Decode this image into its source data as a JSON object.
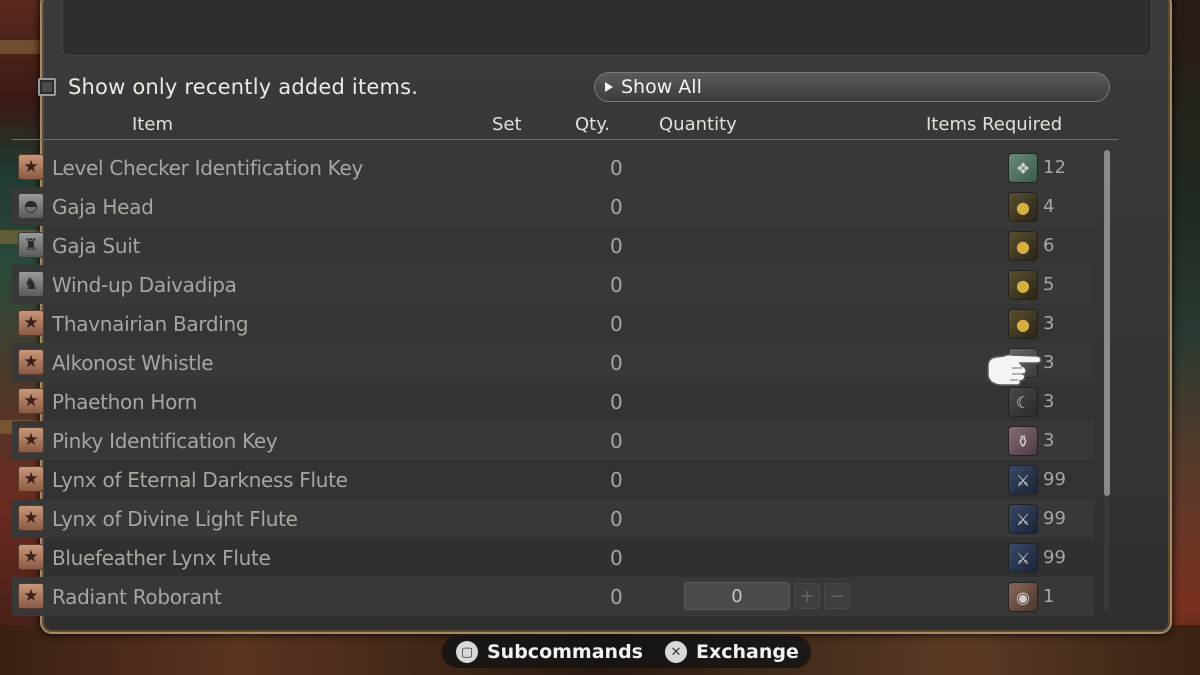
{
  "filter": {
    "label": "Show only recently added items."
  },
  "show_all": {
    "label": "Show All"
  },
  "columns": {
    "item": "Item",
    "set": "Set",
    "qty": "Qty.",
    "quantity": "Quantity",
    "items_required": "Items Required"
  },
  "items": [
    {
      "name": "Level Checker Identification Key",
      "qty": "0",
      "icon": "star-icon",
      "req_icon": "scrip-icon",
      "req_count": "12"
    },
    {
      "name": "Gaja Head",
      "qty": "0",
      "icon": "helmet-icon",
      "req_icon": "gold-egg-icon",
      "req_count": "4"
    },
    {
      "name": "Gaja Suit",
      "qty": "0",
      "icon": "armor-icon",
      "req_icon": "gold-egg-icon",
      "req_count": "6"
    },
    {
      "name": "Wind-up Daivadipa",
      "qty": "0",
      "icon": "minion-icon",
      "req_icon": "gold-egg-icon",
      "req_count": "5"
    },
    {
      "name": "Thavnairian Barding",
      "qty": "0",
      "icon": "star-icon",
      "req_icon": "gold-egg-icon",
      "req_count": "3"
    },
    {
      "name": "Alkonost Whistle",
      "qty": "0",
      "icon": "star-icon",
      "req_icon": "feather-icon",
      "req_count": "3"
    },
    {
      "name": "Phaethon Horn",
      "qty": "0",
      "icon": "star-icon",
      "req_icon": "horn-icon",
      "req_count": "3"
    },
    {
      "name": "Pinky Identification Key",
      "qty": "0",
      "icon": "star-icon",
      "req_icon": "potion-icon",
      "req_count": "3"
    },
    {
      "name": "Lynx of Eternal Darkness Flute",
      "qty": "0",
      "icon": "star-icon",
      "req_icon": "weapon-icon",
      "req_count": "99"
    },
    {
      "name": "Lynx of Divine Light Flute",
      "qty": "0",
      "icon": "star-icon",
      "req_icon": "weapon-icon",
      "req_count": "99"
    },
    {
      "name": "Bluefeather Lynx Flute",
      "qty": "0",
      "icon": "star-icon",
      "req_icon": "weapon-icon",
      "req_count": "99"
    },
    {
      "name": "Radiant Roborant",
      "qty": "0",
      "icon": "star-icon",
      "req_icon": "coin-icon",
      "req_count": "1",
      "quantity_value": "0"
    }
  ],
  "footer": {
    "subcommands": "Subcommands",
    "exchange": "Exchange"
  },
  "colors": {
    "accent_border": "#a58a62",
    "row_alt": "#383838",
    "text_dim": "#a9a69f"
  }
}
